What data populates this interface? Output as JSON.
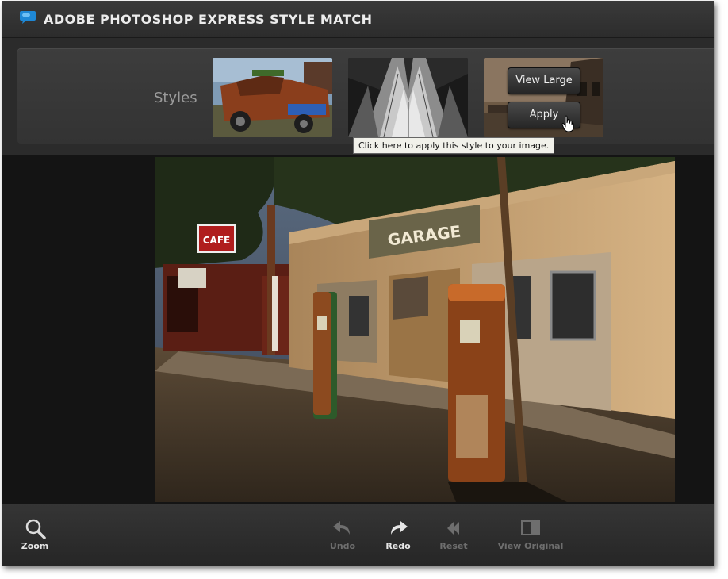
{
  "app": {
    "title": "ADOBE PHOTOSHOP EXPRESS STYLE MATCH",
    "logo_icon": "speech-bubble-icon",
    "accent_color": "#1e88d6"
  },
  "styles_panel": {
    "label": "Styles",
    "thumbnails": [
      {
        "name": "rusty-truck"
      },
      {
        "name": "cathedral-bw"
      },
      {
        "name": "sepia-barn"
      }
    ],
    "overlay": {
      "view_large_label": "View Large",
      "apply_label": "Apply",
      "tooltip": "Click here to apply this style to your image."
    }
  },
  "photo": {
    "sign_cafe": "CAFE",
    "sign_garage": "GARAGE"
  },
  "toolbar": {
    "zoom": {
      "label": "Zoom",
      "icon": "magnifier-icon",
      "enabled": true
    },
    "undo": {
      "label": "Undo",
      "icon": "undo-arrow-icon",
      "enabled": false
    },
    "redo": {
      "label": "Redo",
      "icon": "redo-arrow-icon",
      "enabled": true
    },
    "reset": {
      "label": "Reset",
      "icon": "rewind-icon",
      "enabled": false
    },
    "view_original": {
      "label": "View Original",
      "icon": "split-view-icon",
      "enabled": false
    }
  }
}
